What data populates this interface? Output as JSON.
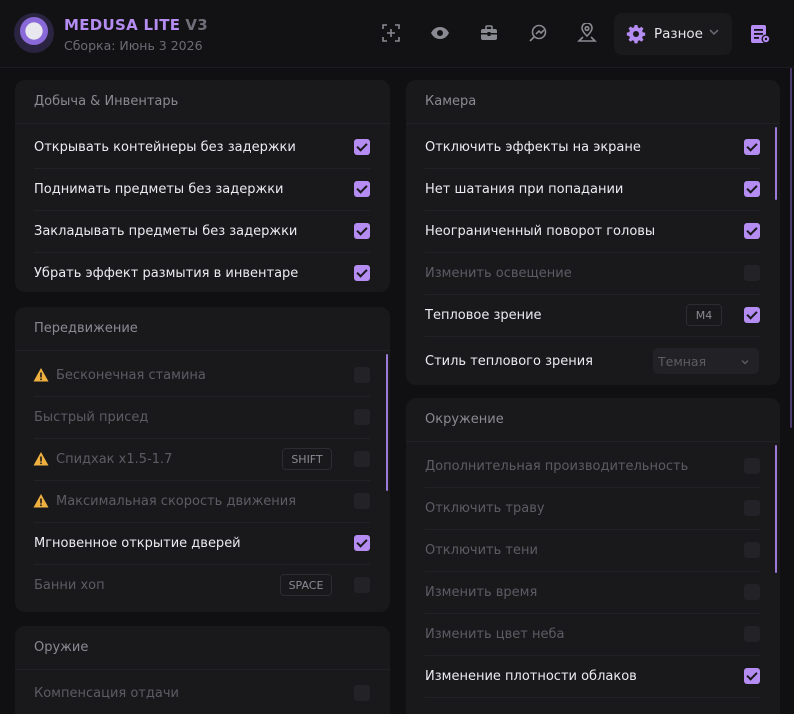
{
  "header": {
    "app_name": "MEDUSA LITE",
    "version": "V3",
    "build": "Сборка: Июнь 3 2026",
    "misc_label": "Разное",
    "accent": "#b48cf2"
  },
  "loot": {
    "title": "Добыча & Инвентарь",
    "items": [
      {
        "label": "Открывать контейнеры без задержки",
        "checked": true
      },
      {
        "label": "Поднимать предметы без задержки",
        "checked": true
      },
      {
        "label": "Закладывать предметы без задержки",
        "checked": true
      },
      {
        "label": "Убрать эффект размытия в инвентаре",
        "checked": true
      }
    ]
  },
  "movement": {
    "title": "Передвижение",
    "items": [
      {
        "label": "Бесконечная стамина",
        "checked": false,
        "warning": true,
        "disabled": true
      },
      {
        "label": "Быстрый присед",
        "checked": false,
        "disabled": true
      },
      {
        "label": "Спидхак x1.5-1.7",
        "checked": false,
        "warning": true,
        "disabled": true,
        "key": "SHIFT"
      },
      {
        "label": "Максимальная скорость движения",
        "checked": false,
        "warning": true,
        "disabled": true
      },
      {
        "label": "Мгновенное открытие дверей",
        "checked": true
      },
      {
        "label": "Банни хоп",
        "checked": false,
        "disabled": true,
        "key": "SPACE"
      }
    ]
  },
  "weapon": {
    "title": "Оружие",
    "items": [
      {
        "label": "Компенсация отдачи",
        "checked": false,
        "disabled": true
      }
    ]
  },
  "camera": {
    "title": "Камера",
    "items": [
      {
        "label": "Отключить эффекты на экране",
        "checked": true
      },
      {
        "label": "Нет шатания при попадании",
        "checked": true
      },
      {
        "label": "Неограниченный поворот головы",
        "checked": true
      },
      {
        "label": "Изменить освещение",
        "checked": false,
        "disabled": true
      },
      {
        "label": "Тепловое зрение",
        "checked": true,
        "key": "M4"
      }
    ],
    "thermal_style_label": "Стиль теплового зрения",
    "thermal_style_value": "Темная"
  },
  "environment": {
    "title": "Окружение",
    "items": [
      {
        "label": "Дополнительная производительность",
        "checked": false,
        "disabled": true
      },
      {
        "label": "Отключить траву",
        "checked": false,
        "disabled": true
      },
      {
        "label": "Отключить тени",
        "checked": false,
        "disabled": true
      },
      {
        "label": "Изменить время",
        "checked": false,
        "disabled": true
      },
      {
        "label": "Изменить цвет неба",
        "checked": false,
        "disabled": true
      },
      {
        "label": "Изменение плотности облаков",
        "checked": true
      }
    ]
  },
  "icons": [
    "logo",
    "crosshair-icon",
    "eye-icon",
    "toolbox-icon",
    "radar-icon",
    "map-pin-icon",
    "gear-icon",
    "chevron-down-icon",
    "settings-list-icon",
    "warning-icon"
  ]
}
